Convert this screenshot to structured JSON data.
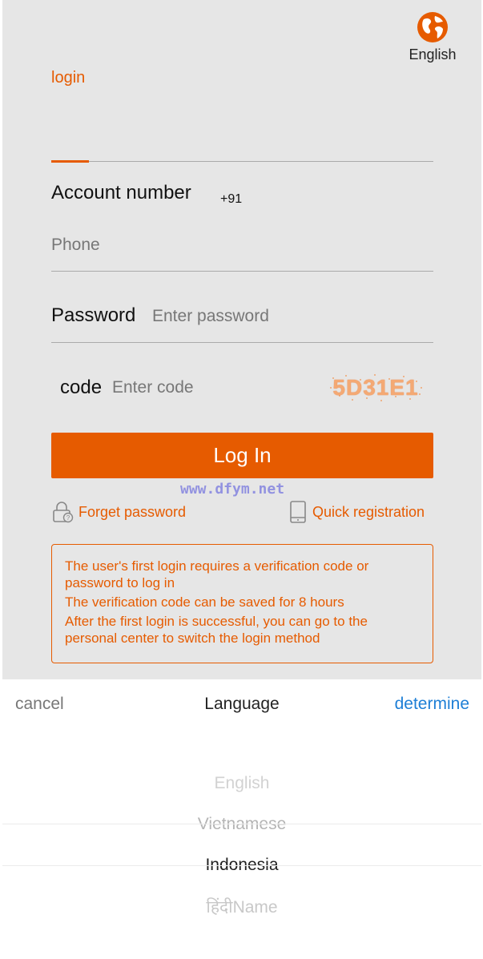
{
  "colors": {
    "accent": "#e65b00",
    "link_blue": "#1e7fd6",
    "page_background": "#e6e6e6"
  },
  "header": {
    "language_icon": "globe-icon",
    "language_label": "English"
  },
  "tabs": {
    "login_label": "login"
  },
  "account": {
    "label": "Account number",
    "country_code": "+91",
    "placeholder": "Phone"
  },
  "password": {
    "label": "Password",
    "placeholder": "Enter password"
  },
  "code": {
    "label": "code",
    "placeholder": "Enter code",
    "captcha_text": "5D31E1"
  },
  "login_button": {
    "label": "Log In"
  },
  "watermark": "www.dfym.net",
  "links": {
    "forget_icon": "lock-question-icon",
    "forget_label": "Forget password",
    "register_icon": "phone-icon",
    "register_label": "Quick registration"
  },
  "notice": {
    "lines": [
      "The user's first login requires a verification code or password to log in",
      "The verification code can be saved for 8 hours",
      "After the first login is successful, you can go to the personal center to switch the login method"
    ]
  },
  "language_sheet": {
    "cancel_label": "cancel",
    "title": "Language",
    "confirm_label": "determine",
    "options": [
      "English",
      "Vietnamese",
      "Indonesia",
      "हिंदीName"
    ],
    "selected": "Indonesia"
  }
}
